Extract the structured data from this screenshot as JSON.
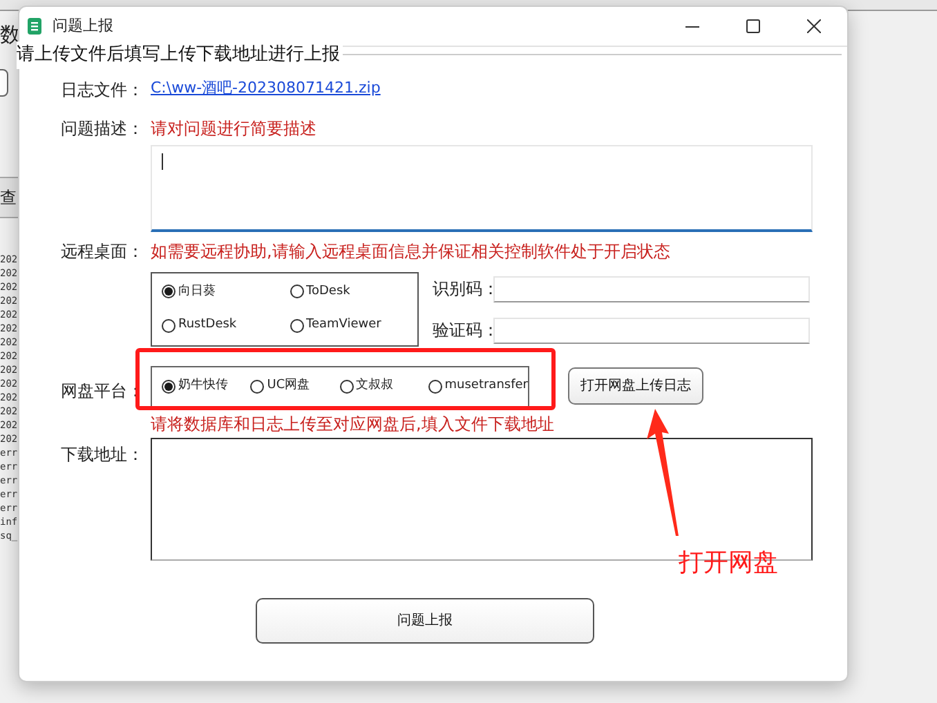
{
  "background_app": {
    "side_texts": [
      "数",
      "查"
    ],
    "log_lines": [
      "202",
      "202",
      "202",
      "202",
      "202",
      "202",
      "202",
      "202",
      "202",
      "202",
      "202",
      "202",
      "202",
      "202",
      "err",
      "err",
      "err",
      "err",
      "err",
      "inf",
      "sq_"
    ]
  },
  "window": {
    "title": "问题上报"
  },
  "header": "请上传文件后填写上传下载地址进行上报",
  "log_file": {
    "label": "日志文件：",
    "link": "C:\\ww-酒吧-202308071421.zip"
  },
  "description": {
    "label": "问题描述：",
    "hint": "请对问题进行简要描述"
  },
  "remote_desktop": {
    "label": "远程桌面：",
    "hint": "如需要远程协助,请输入远程桌面信息并保证相关控制软件处于开启状态",
    "options": [
      {
        "label": "向日葵",
        "selected": true
      },
      {
        "label": "ToDesk",
        "selected": false
      },
      {
        "label": "RustDesk",
        "selected": false
      },
      {
        "label": "TeamViewer",
        "selected": false
      }
    ],
    "fields": [
      {
        "label": "识别码："
      },
      {
        "label": "验证码："
      }
    ]
  },
  "netdisk": {
    "label": "网盘平台：",
    "options": [
      {
        "label": "奶牛快传",
        "selected": true
      },
      {
        "label": "UC网盘",
        "selected": false
      },
      {
        "label": "文叔叔",
        "selected": false
      },
      {
        "label": "musetransfer",
        "selected": false
      }
    ],
    "button": "打开网盘上传日志",
    "hint": "请将数据库和日志上传至对应网盘后,填入文件下载地址"
  },
  "download": {
    "label": "下载地址："
  },
  "submit_button": "问题上报",
  "annotation": {
    "text": "打开网盘"
  }
}
